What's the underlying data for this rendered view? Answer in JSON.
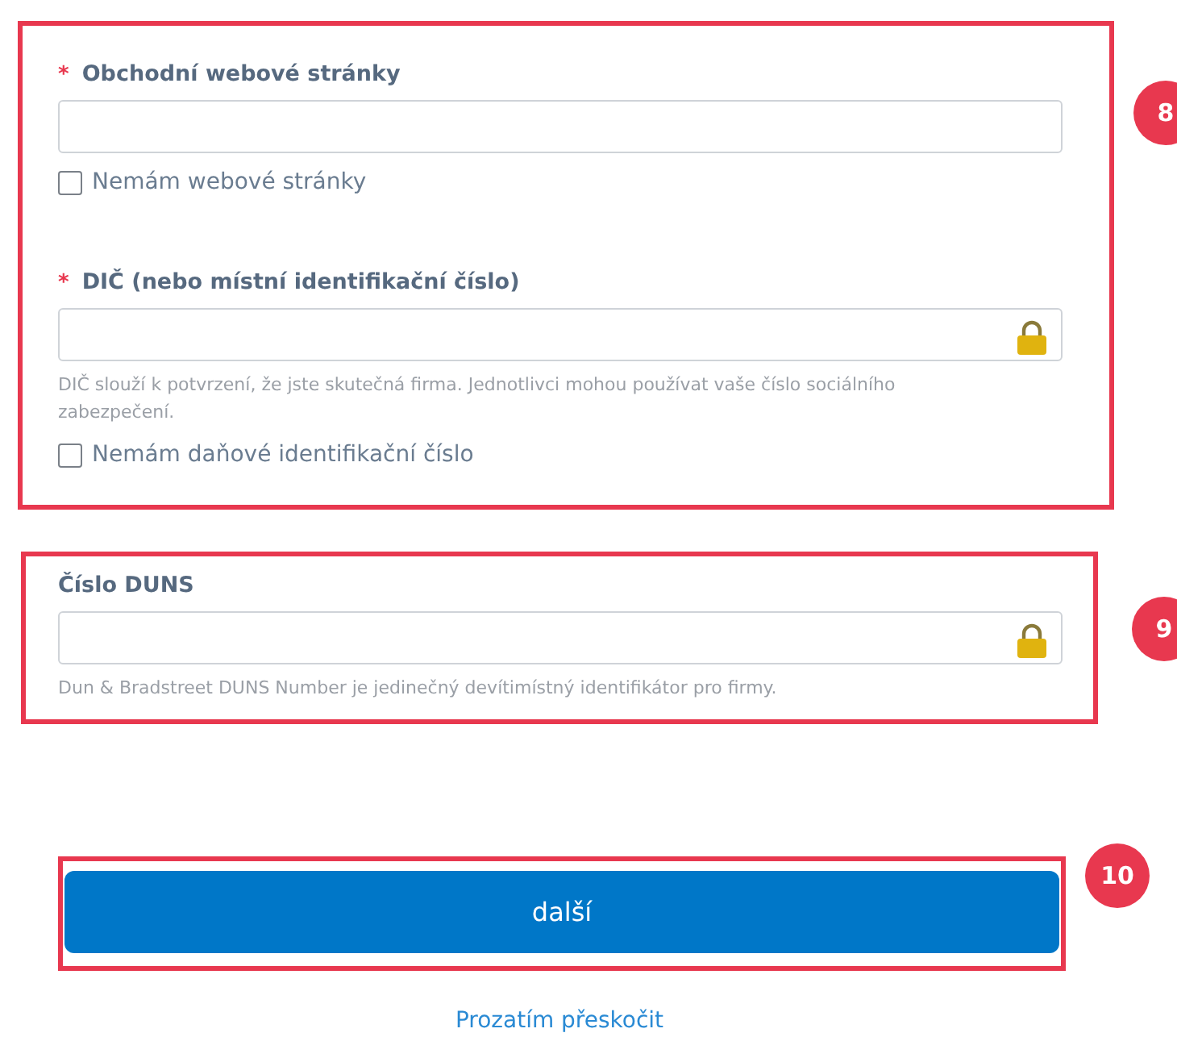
{
  "groups": [
    {
      "marker": "8",
      "items": [
        {
          "kind": "input",
          "required_mark": "*",
          "label": "Obchodní webové stránky"
        },
        {
          "kind": "checkbox",
          "label": "Nemám webové stránky",
          "checked": false
        },
        {
          "kind": "input",
          "required_mark": "*",
          "label": "DIČ (nebo místní identifikační číslo)",
          "locked": true,
          "hint": "DIČ slouží k potvrzení, že jste skutečná firma. Jednotlivci mohou používat vaše číslo sociálního zabezpečení."
        },
        {
          "kind": "checkbox",
          "label": "Nemám daňové identifikační číslo",
          "checked": false
        }
      ]
    },
    {
      "marker": "9",
      "items": [
        {
          "kind": "input",
          "label": "Číslo DUNS",
          "locked": true,
          "hint": "Dun & Bradstreet DUNS Number je jedinečný devítimístný identifikátor pro firmy."
        }
      ]
    }
  ],
  "next": {
    "marker": "10",
    "label": "další"
  },
  "skip_link": "Prozatím přeskočit"
}
